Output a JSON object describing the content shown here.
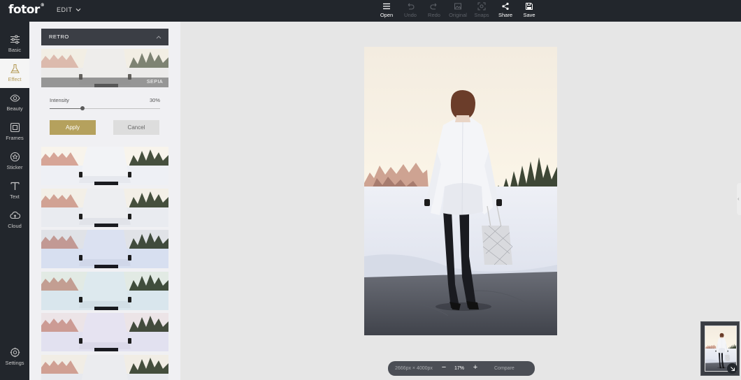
{
  "app": {
    "logo": "fotor",
    "logo_mark": "®",
    "menu_label": "EDIT"
  },
  "toolbar": [
    {
      "label": "Open",
      "icon": "menu-icon",
      "enabled": true
    },
    {
      "label": "Undo",
      "icon": "undo-icon",
      "enabled": false
    },
    {
      "label": "Redo",
      "icon": "redo-icon",
      "enabled": false
    },
    {
      "label": "Original",
      "icon": "original-icon",
      "enabled": false
    },
    {
      "label": "Snaps",
      "icon": "snapshot-icon",
      "enabled": false
    },
    {
      "label": "Share",
      "icon": "share-icon",
      "enabled": true
    },
    {
      "label": "Save",
      "icon": "save-icon",
      "enabled": true
    }
  ],
  "sidebar": {
    "items": [
      {
        "label": "Basic",
        "icon": "sliders-icon"
      },
      {
        "label": "Effect",
        "icon": "flask-icon",
        "active": true
      },
      {
        "label": "Beauty",
        "icon": "eye-icon"
      },
      {
        "label": "Frames",
        "icon": "frame-icon"
      },
      {
        "label": "Sticker",
        "icon": "sticker-icon"
      },
      {
        "label": "Text",
        "icon": "text-icon"
      },
      {
        "label": "Cloud",
        "icon": "cloud-icon"
      }
    ],
    "settings_label": "Settings"
  },
  "effect_panel": {
    "category": "RETRO",
    "selected_effect": "SEPIA",
    "intensity_label": "Intensity",
    "intensity_value": "30%",
    "intensity_fraction": 0.3,
    "apply_label": "Apply",
    "cancel_label": "Cancel",
    "filter_tints": [
      "#ffffff",
      "#f4f4f4",
      "#c9d6f3",
      "#cfe9ec",
      "#e4dbf3",
      "#efefef"
    ]
  },
  "canvas": {
    "dimensions": "2666px × 4000px",
    "zoom_minus": "−",
    "zoom_level": "17%",
    "zoom_plus": "+",
    "compare_label": "Compare"
  },
  "colors": {
    "accent": "#b5a15d",
    "dark_ui": "#22262c",
    "panel_bg": "#f0f0f3",
    "canvas_bg": "#e6e6e6"
  }
}
